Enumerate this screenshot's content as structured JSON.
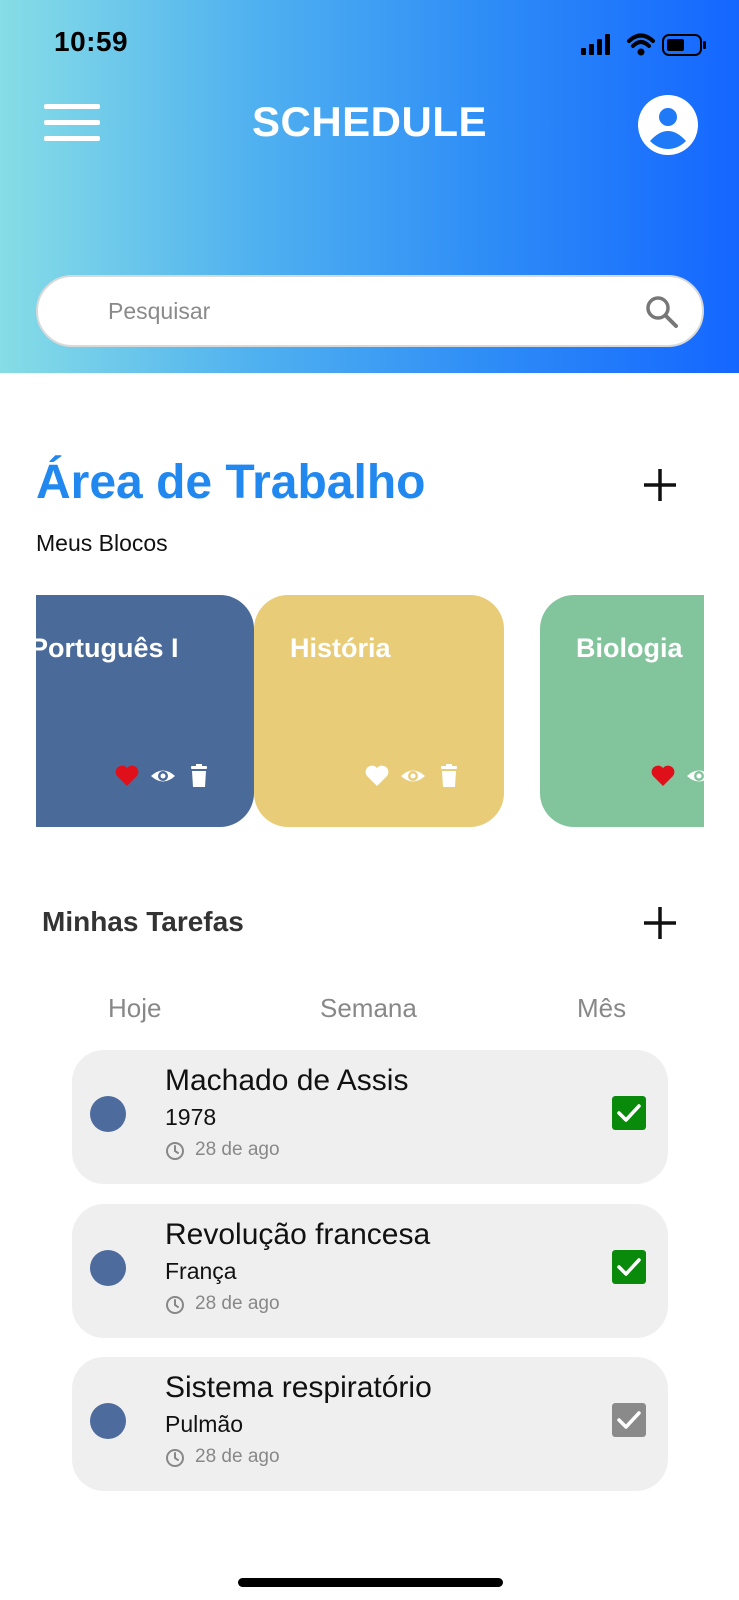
{
  "status_bar": {
    "time": "10:59"
  },
  "header": {
    "title": "SCHEDULE",
    "search": {
      "placeholder": "Pesquisar",
      "value": ""
    }
  },
  "workspace": {
    "title": "Área de Trabalho",
    "subtitle": "Meus Blocos",
    "blocks": [
      {
        "title": "Português I",
        "color": "#4a6a9a",
        "favorite": true
      },
      {
        "title": "História",
        "color": "#e8cc78",
        "favorite": false
      },
      {
        "title": "Biologia",
        "color": "#82c59d",
        "favorite": true
      }
    ]
  },
  "tasks": {
    "title": "Minhas Tarefas",
    "tabs": [
      "Hoje",
      "Semana",
      "Mês"
    ],
    "items": [
      {
        "title": "Machado de Assis",
        "subtitle": "1978",
        "date": "28 de ago",
        "checked": true,
        "check_color": "#0a8a0a"
      },
      {
        "title": "Revolução francesa",
        "subtitle": "França",
        "date": "28 de ago",
        "checked": true,
        "check_color": "#0a8a0a"
      },
      {
        "title": "Sistema respiratório",
        "subtitle": "Pulmão",
        "date": "28 de ago",
        "checked": true,
        "check_color": "#8a8a8a"
      }
    ]
  },
  "colors": {
    "accent": "#2188f0",
    "favorite_red": "#e0101b",
    "task_dot": "#4d6b9c"
  }
}
